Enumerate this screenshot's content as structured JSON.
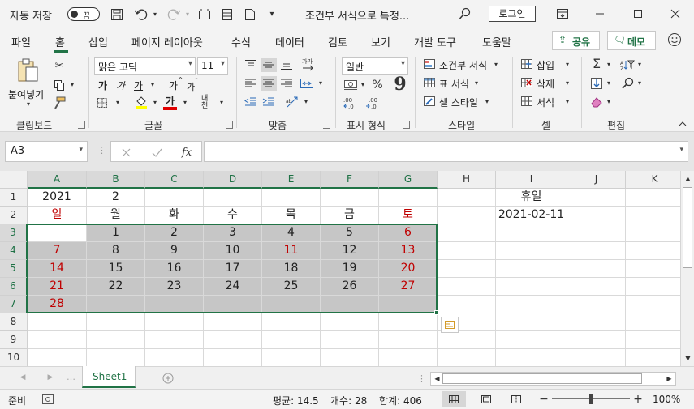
{
  "title_bar": {
    "autosave_label": "자동 저장",
    "autosave_state": "끔",
    "doc_title": "조건부 서식으로 특정...",
    "login": "로그인"
  },
  "menu": {
    "items": [
      "파일",
      "홈",
      "삽입",
      "페이지 레이아웃",
      "수식",
      "데이터",
      "검토",
      "보기",
      "개발 도구",
      "도움말"
    ],
    "active": "홈",
    "share": "공유",
    "memo": "메모"
  },
  "ribbon": {
    "paste": "붙여넣기",
    "font_name": "맑은 고딕",
    "font_size": "11",
    "bold": "가",
    "italic": "가",
    "underline": "가",
    "grow_font": "가",
    "shrink_font": "가",
    "font_color": "가",
    "phonetic": "내천",
    "number_format": "일반",
    "cond_format": "조건부 서식",
    "table_format": "표 서식",
    "cell_style": "셀 스타일",
    "insert": "삽입",
    "delete": "삭제",
    "format": "서식",
    "groups": {
      "clipboard": "클립보드",
      "font": "글꼴",
      "align": "맞춤",
      "number": "표시 형식",
      "style": "스타일",
      "cells": "셀",
      "edit": "편집"
    }
  },
  "formula_bar": {
    "name_box": "A3",
    "fx": "fx",
    "value": ""
  },
  "sheet": {
    "columns": [
      "A",
      "B",
      "C",
      "D",
      "E",
      "F",
      "G",
      "H",
      "I",
      "J",
      "K"
    ],
    "rows": [
      "1",
      "2",
      "3",
      "4",
      "5",
      "6",
      "7",
      "8",
      "9",
      "10"
    ],
    "cells": {
      "A1": "2021",
      "B1": "2",
      "I1": "휴일",
      "A2": "일",
      "B2": "월",
      "C2": "화",
      "D2": "수",
      "E2": "목",
      "F2": "금",
      "G2": "토",
      "I2": "2021-02-11",
      "B3": "1",
      "C3": "2",
      "D3": "3",
      "E3": "4",
      "F3": "5",
      "G3": "6",
      "A4": "7",
      "B4": "8",
      "C4": "9",
      "D4": "10",
      "E4": "11",
      "F4": "12",
      "G4": "13",
      "A5": "14",
      "B5": "15",
      "C5": "16",
      "D5": "17",
      "E5": "18",
      "F5": "19",
      "G5": "20",
      "A6": "21",
      "B6": "22",
      "C6": "23",
      "D6": "24",
      "E6": "25",
      "F6": "26",
      "G6": "27",
      "A7": "28"
    },
    "red_cells": [
      "A2",
      "G2",
      "G3",
      "A4",
      "E4",
      "G4",
      "A5",
      "G5",
      "A6",
      "G6",
      "A7"
    ],
    "selection": "A3:G7",
    "active_cell": "A3",
    "selected_columns": [
      "A",
      "B",
      "C",
      "D",
      "E",
      "F",
      "G"
    ],
    "selected_rows": [
      "3",
      "4",
      "5",
      "6",
      "7"
    ]
  },
  "tabs": {
    "sheet1": "Sheet1"
  },
  "status": {
    "ready": "준비",
    "average": "평균: 14.5",
    "count": "개수: 28",
    "sum": "합계: 406",
    "zoom": "100%"
  },
  "colors": {
    "red_text": "#c00000",
    "selection_fill": "#c6c6c6",
    "excel_green": "#217346"
  }
}
